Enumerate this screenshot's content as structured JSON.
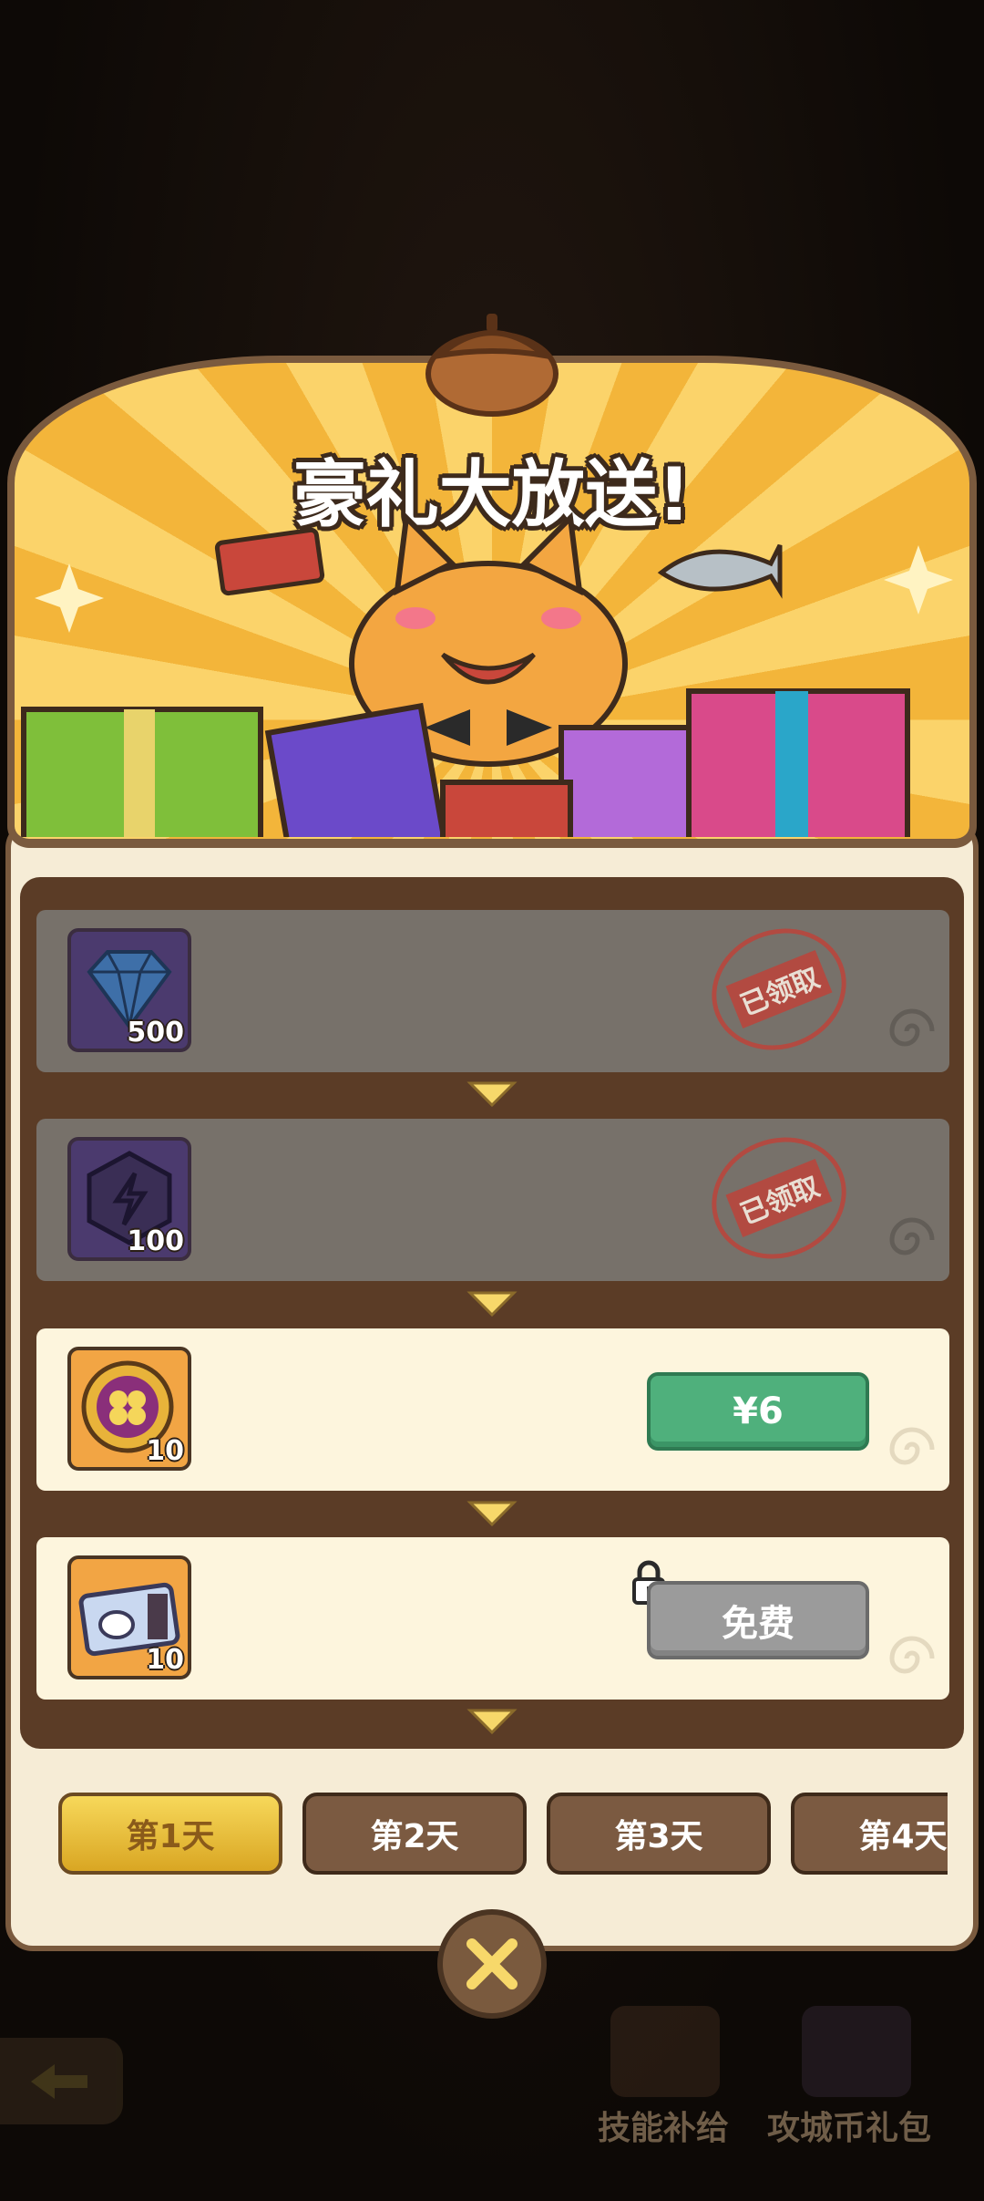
{
  "banner": {
    "title": "豪礼大放送!"
  },
  "rows": [
    {
      "qty": "500",
      "status": "已领取",
      "icon": "diamond-icon"
    },
    {
      "qty": "100",
      "status": "已领取",
      "icon": "energy-badge-icon"
    },
    {
      "qty": "10",
      "price": "¥6",
      "icon": "clover-coin-icon"
    },
    {
      "qty": "10",
      "price": "免费",
      "icon": "rabbit-ticket-icon",
      "locked": true
    }
  ],
  "tabs": [
    "第1天",
    "第2天",
    "第3天",
    "第4天"
  ],
  "background": {
    "label_skill": "技能补给",
    "label_siege": "攻城币礼包"
  }
}
